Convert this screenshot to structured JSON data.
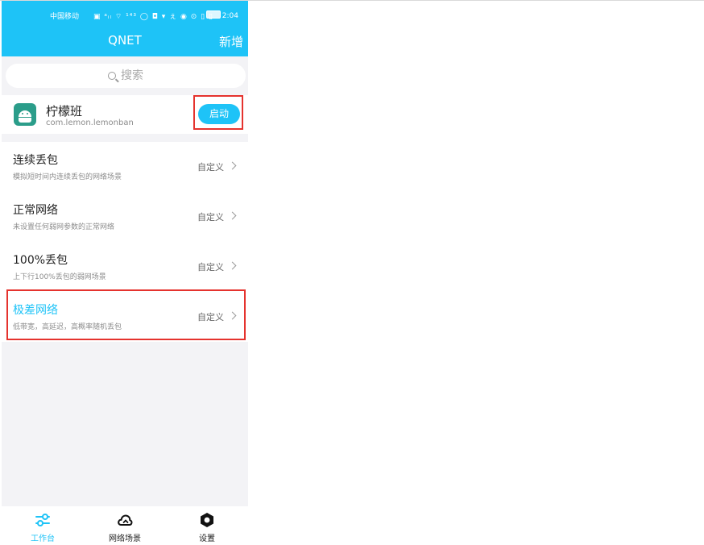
{
  "status_bar": {
    "carrier": "中国移动",
    "icons": "▣ ᵃᵢₗ ⌔ ¹⁴³ ◯ ◘ ▾ ぇ ◉ ⊙ ▯ ▯",
    "battery": "",
    "time": "2:04"
  },
  "header": {
    "title": "QNET",
    "add_label": "新增"
  },
  "search": {
    "placeholder": "搜索"
  },
  "app": {
    "name": "柠檬班",
    "package": "com.lemon.lemonban",
    "start_label": "启动"
  },
  "scenarios": [
    {
      "title": "连续丢包",
      "desc": "模拟短时间内连续丢包的网络场景",
      "action": "自定义"
    },
    {
      "title": "正常网络",
      "desc": "未设置任何弱网参数的正常网络",
      "action": "自定义"
    },
    {
      "title": "100%丢包",
      "desc": "上下行100%丢包的弱网场景",
      "action": "自定义"
    },
    {
      "title": "极差网络",
      "desc": "低带宽，高延迟，高概率随机丢包",
      "action": "自定义"
    }
  ],
  "tabs": [
    {
      "label": "工作台",
      "icon": "sliders-icon"
    },
    {
      "label": "网络场景",
      "icon": "cloud-icon"
    },
    {
      "label": "设置",
      "icon": "hexagon-gear-icon"
    }
  ],
  "colors": {
    "accent": "#1ec3f7",
    "highlight": "#e5332e"
  }
}
